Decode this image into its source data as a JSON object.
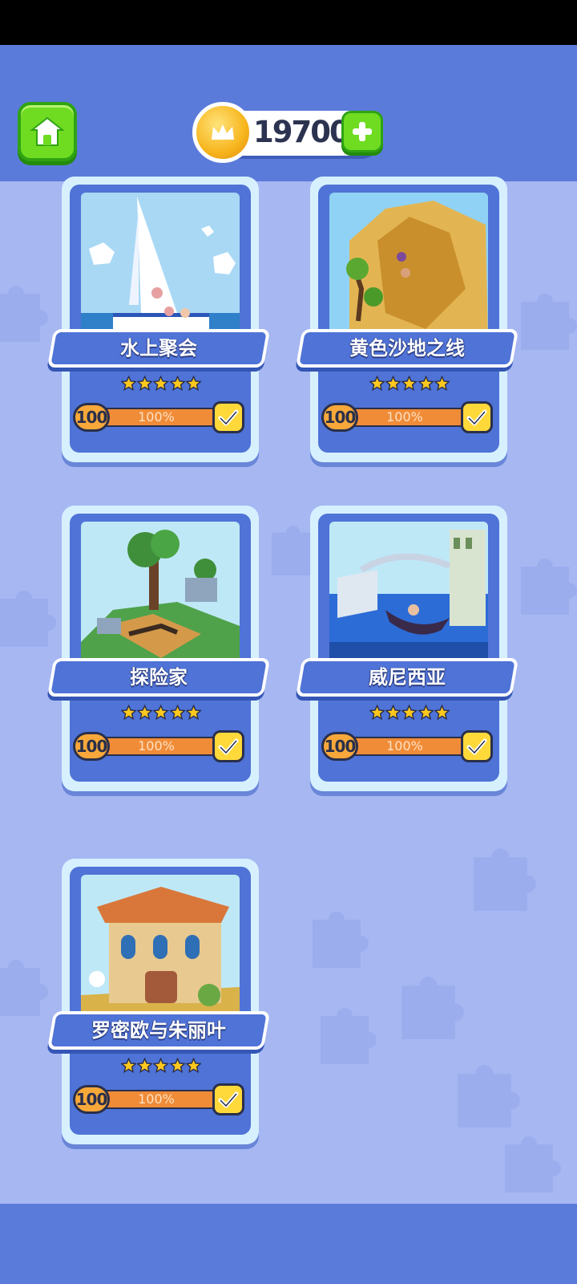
{
  "header": {
    "coins": "19700",
    "home_icon": "home-icon",
    "add_icon": "plus-icon",
    "coin_icon": "crown-coin-icon"
  },
  "colors": {
    "header_bg": "#5b7bdb",
    "page_bg": "#a6b7f2",
    "card_blue": "#4f73d6",
    "progress_orange": "#f08c38",
    "green_button": "#6fdc22",
    "star_gold": "#ffc81e"
  },
  "levels": [
    {
      "name": "水上聚会",
      "stars": 5,
      "level": "100",
      "progress_label": "100%",
      "progress": 1.0,
      "completed": true
    },
    {
      "name": "黄色沙地之线",
      "stars": 5,
      "level": "100",
      "progress_label": "100%",
      "progress": 1.0,
      "completed": true
    },
    {
      "name": "探险家",
      "stars": 5,
      "level": "100",
      "progress_label": "100%",
      "progress": 1.0,
      "completed": true
    },
    {
      "name": "威尼西亚",
      "stars": 5,
      "level": "100",
      "progress_label": "100%",
      "progress": 1.0,
      "completed": true
    },
    {
      "name": "罗密欧与朱丽叶",
      "stars": 5,
      "level": "100",
      "progress_label": "100%",
      "progress": 1.0,
      "completed": true
    }
  ]
}
